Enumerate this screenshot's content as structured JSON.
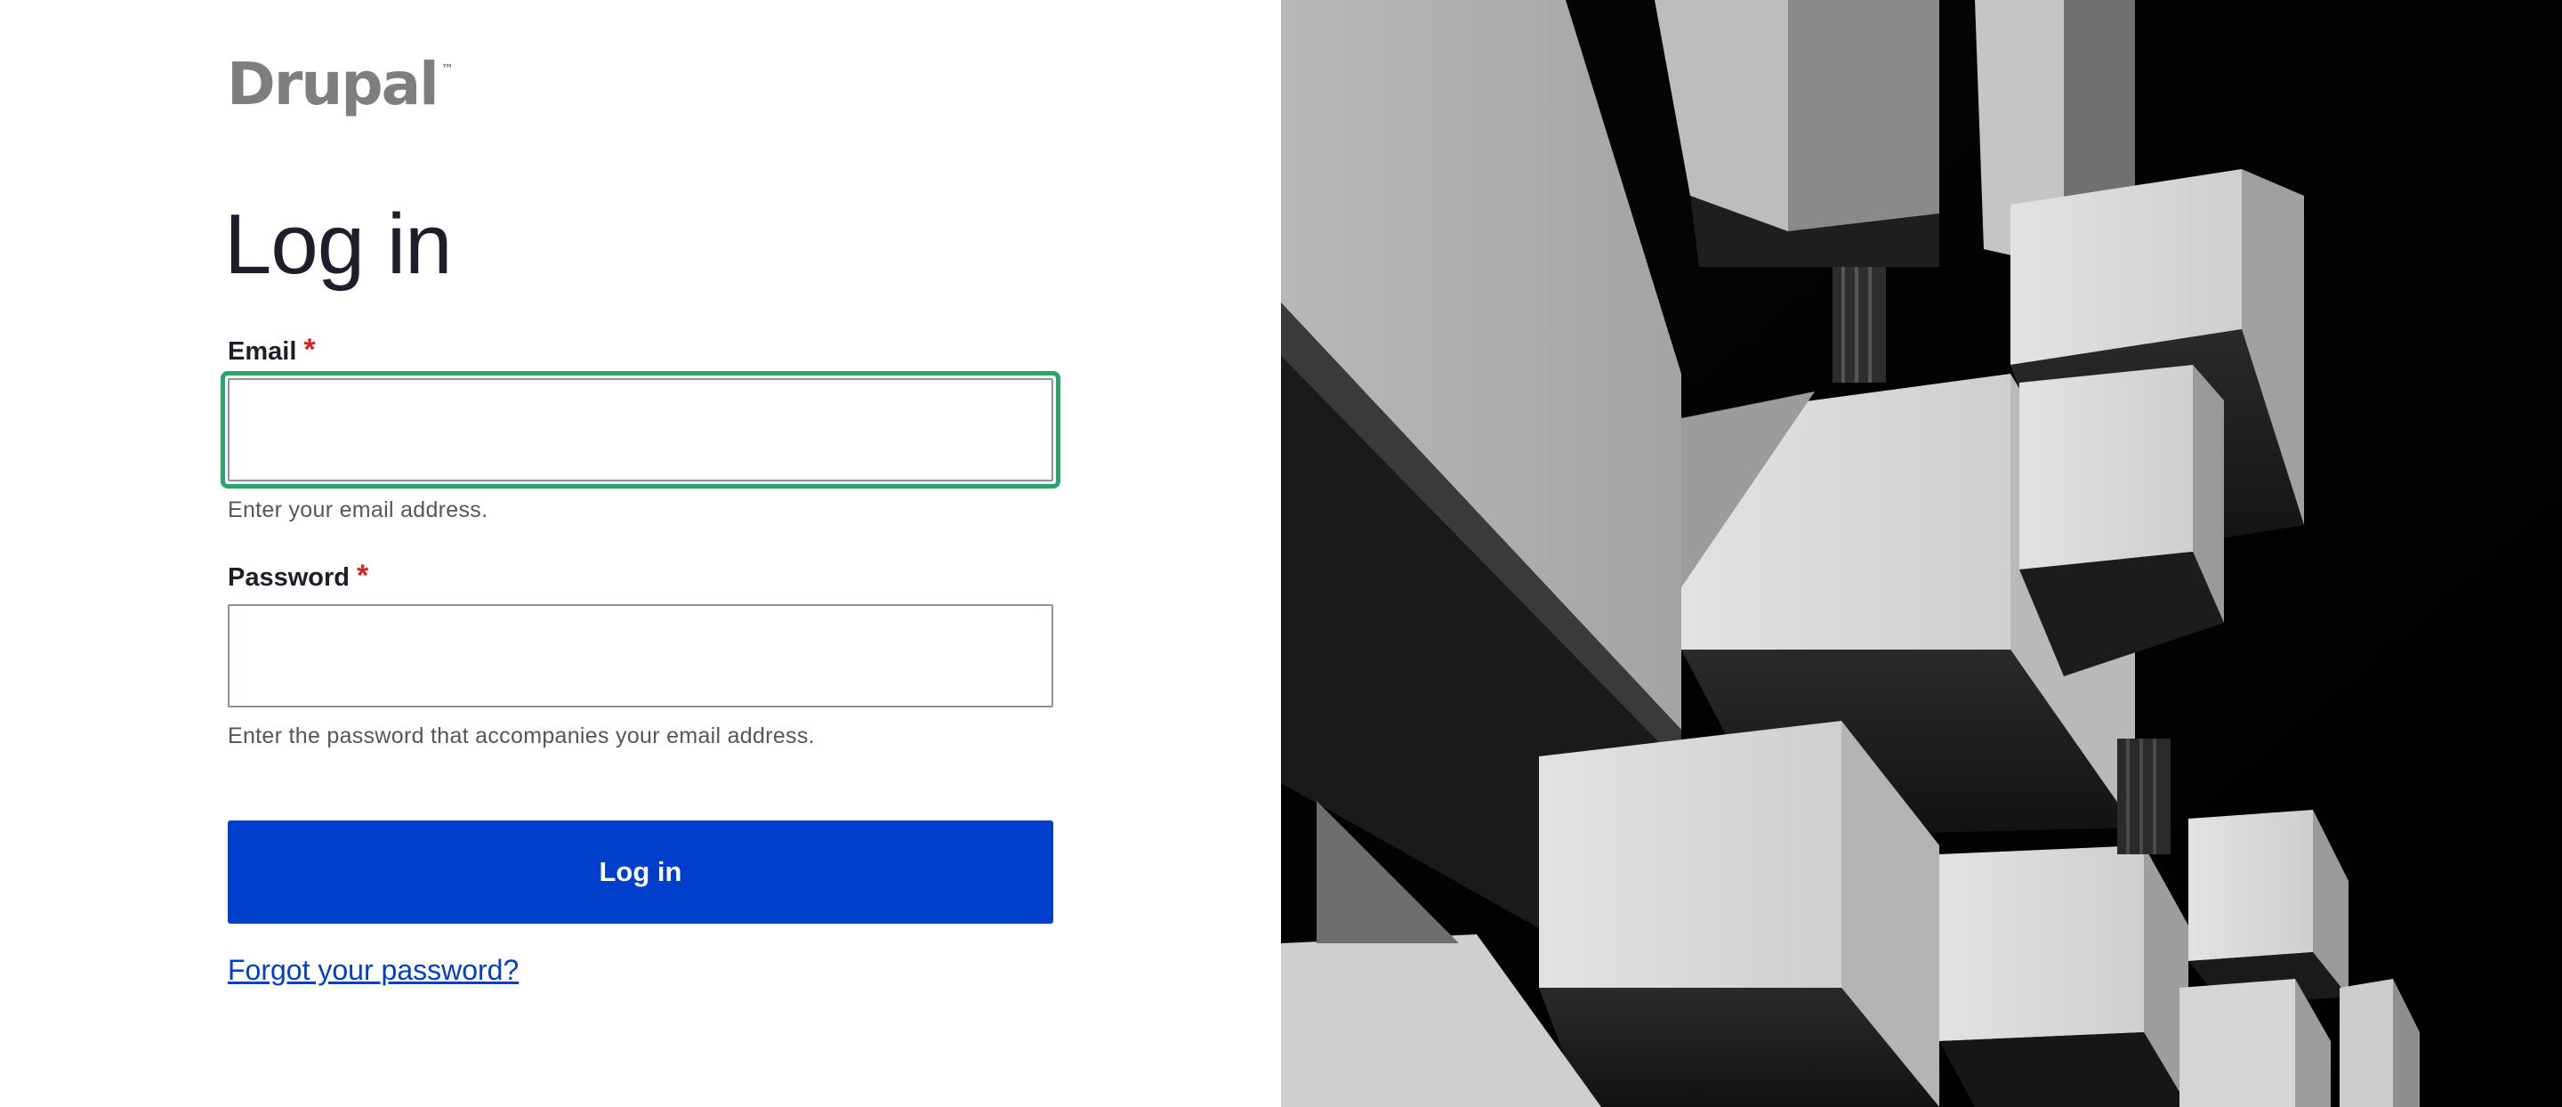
{
  "brand": {
    "logo_text": "Drupal",
    "logo_tm": "™"
  },
  "form": {
    "title": "Log in",
    "email": {
      "label": "Email",
      "required_mark": "*",
      "value": "",
      "help": "Enter your email address."
    },
    "password": {
      "label": "Password",
      "required_mark": "*",
      "value": "",
      "help": "Enter the password that accompanies your email address."
    },
    "submit_label": "Log in",
    "forgot_link": "Forgot your password?"
  },
  "colors": {
    "primary": "#003ecc",
    "focus_ring": "#26a769",
    "required": "#d72222",
    "logo_gray": "#7e7e7e",
    "title_text": "#1e1e2a"
  },
  "decor": {
    "right_image": "architecture-balconies-photo"
  }
}
